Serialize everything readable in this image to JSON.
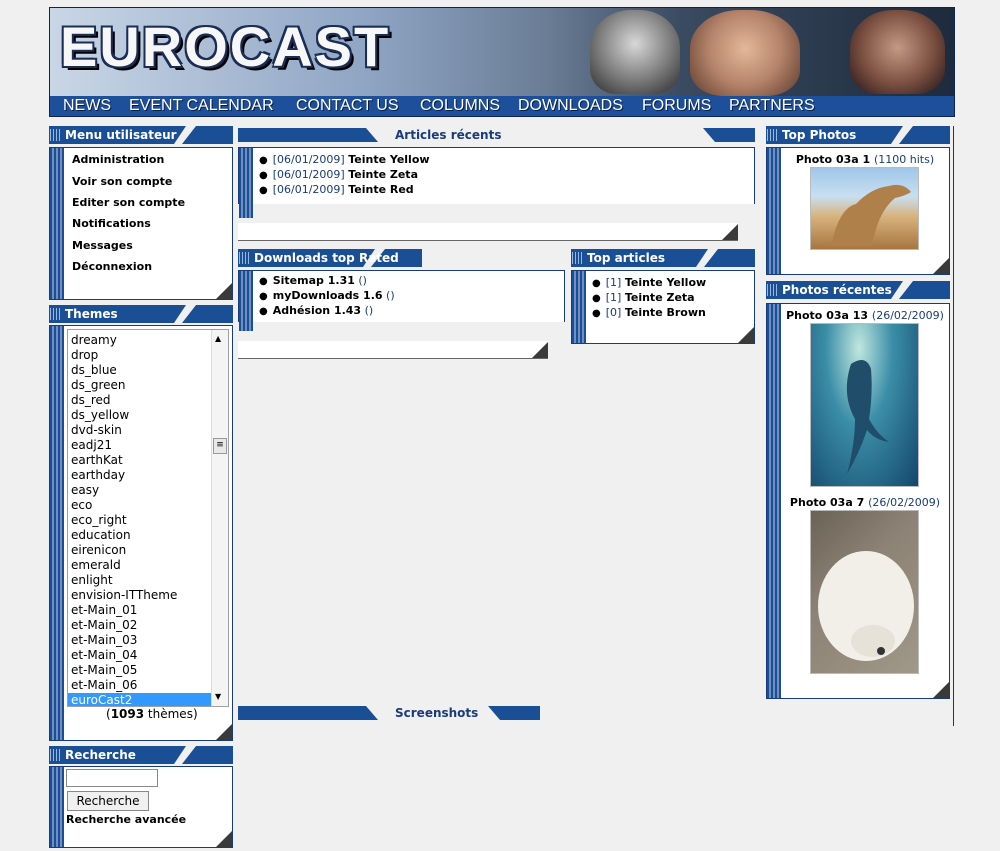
{
  "header": {
    "logo_text": "EUROCAST",
    "nav": [
      "NEWS",
      "EVENT CALENDAR",
      "CONTACT US",
      "COLUMNS",
      "DOWNLOADS",
      "FORUMS",
      "PARTNERS"
    ]
  },
  "user_menu": {
    "title": "Menu utilisateur",
    "items": [
      "Administration",
      "Voir son compte",
      "Editer son compte",
      "Notifications",
      "Messages",
      "Déconnexion"
    ]
  },
  "themes": {
    "title": "Themes",
    "options": [
      "dreamy",
      "drop",
      "ds_blue",
      "ds_green",
      "ds_red",
      "ds_yellow",
      "dvd-skin",
      "eadj21",
      "earthKat",
      "earthday",
      "easy",
      "eco",
      "eco_right",
      "education",
      "eirenicon",
      "emerald",
      "enlight",
      "envision-ITTheme",
      "et-Main_01",
      "et-Main_02",
      "et-Main_03",
      "et-Main_04",
      "et-Main_05",
      "et-Main_06",
      "euroCast2"
    ],
    "selected": "euroCast2",
    "count": "1093",
    "count_suffix": "thèmes"
  },
  "search": {
    "title": "Recherche",
    "input_value": "",
    "button_label": "Recherche",
    "advanced_link": "Recherche avancée"
  },
  "recent_articles": {
    "title": "Articles récents",
    "items": [
      {
        "date": "[06/01/2009]",
        "name": "Teinte Yellow"
      },
      {
        "date": "[06/01/2009]",
        "name": "Teinte Zeta"
      },
      {
        "date": "[06/01/2009]",
        "name": "Teinte Red"
      }
    ]
  },
  "downloads_top": {
    "title": "Downloads top Rated",
    "items": [
      {
        "name": "Sitemap 1.31",
        "extra": "()"
      },
      {
        "name": "myDownloads 1.6",
        "extra": "()"
      },
      {
        "name": "Adhésion 1.43",
        "extra": "()"
      }
    ]
  },
  "top_articles": {
    "title": "Top articles",
    "items": [
      {
        "count": "[1]",
        "name": "Teinte Yellow"
      },
      {
        "count": "[1]",
        "name": "Teinte Zeta"
      },
      {
        "count": "[0]",
        "name": "Teinte Brown"
      }
    ]
  },
  "screenshots": {
    "title": "Screenshots"
  },
  "top_photos": {
    "title": "Top Photos",
    "caption": "Photo 03a 1",
    "meta": "(1100 hits)"
  },
  "recent_photos": {
    "title": "Photos récentes",
    "items": [
      {
        "caption": "Photo 03a 13",
        "meta": "(26/02/2009)"
      },
      {
        "caption": "Photo 03a 7",
        "meta": "(26/02/2009)"
      }
    ]
  },
  "colors": {
    "navy": "#1a3b78",
    "block_blue": "#1a4f95",
    "select_blue": "#3399ff",
    "background": "#f0f0f0"
  }
}
